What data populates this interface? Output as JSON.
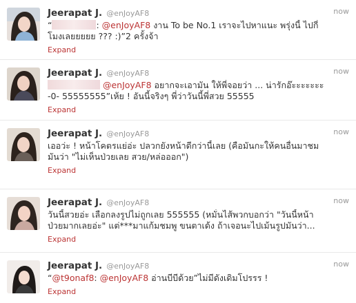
{
  "colors": {
    "accent": "#bb3333",
    "meta": "#999999",
    "text": "#333333",
    "divider": "#e8e8e8"
  },
  "tweets": [
    {
      "name": "Jeerapat J.",
      "handle": "@enJoyAF8",
      "time": "now",
      "line1_prefix": "“",
      "line1_mention": "@enJoyAF8",
      "line1_text": " งาน To be No.1 เราจะไปหาแนะ พรุ่งนี้ ไปกี่",
      "line2_text": "โมงเลยยยยย ??? :)”2 ครั้งจ้า",
      "expand": "Expand"
    },
    {
      "name": "Jeerapat J.",
      "handle": "@enJoyAF8",
      "time": "now",
      "line1_mention": "@enJoyAF8",
      "line1_text": " อยากจะเอามัน ให้พี่จอยว่า ... น่ารักอ๊ะะะะะะะ",
      "line2_text": "-0- 55555555”เห้ย ! อันนี้จริงๆ พี่ว่าวันนี้พี่สวย 55555",
      "expand": "Expand"
    },
    {
      "name": "Jeerapat J.",
      "handle": "@enJoyAF8",
      "time": "now",
      "line1_text": "เออว่ะ ! หน้าโคตรแย่อ่ะ ปลวกยังหน้าดีกว่านี้เลย (คือมันกะให้คนอื่นมาชม",
      "line2_text": "มันว่า \"ไม่เห็นป่วยเลย สวย/หล่อออก\")",
      "expand": "Expand"
    },
    {
      "name": "Jeerapat J.",
      "handle": "@enJoyAF8",
      "time": "now",
      "line1_text": "วันนี้สวยอ่ะ เลือกลงรูปไม่ถูกเลย 555555 (หมั่นไส้พวกบอกว่า \"วันนี้หน้า",
      "line2_text": "ป่วยมากเลยอ่ะ\" แต่***มาแก้มชมพู ขนตาเด้ง ถ้าเจอนะไปเม้นรูปมันว่า...",
      "expand": "Expand"
    },
    {
      "name": "Jeerapat J.",
      "handle": "@enJoyAF8",
      "time": "now",
      "line1_prefix": "“",
      "line1_mention": "@t9onaf8",
      "line1_mid": ": ",
      "line1_mention2": "@enJoyAF8",
      "line1_text": " อ่านบีบีด้วย”ไม่มีดังเดิมโปรรร !",
      "expand": "Expand"
    }
  ]
}
